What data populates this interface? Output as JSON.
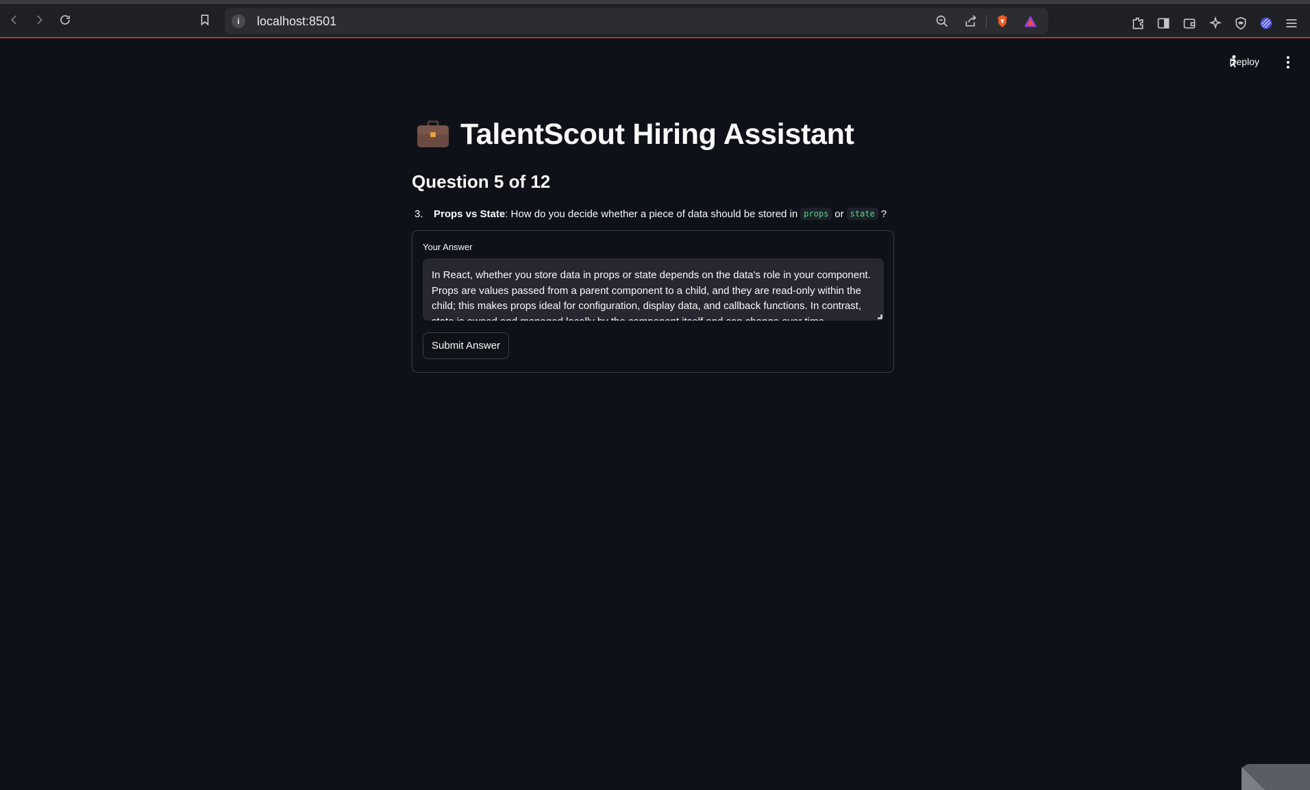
{
  "browser": {
    "url": "localhost:8501",
    "info_icon": "info-icon"
  },
  "header": {
    "deploy_label": "Deploy"
  },
  "main": {
    "title": "TalentScout Hiring Assistant",
    "title_icon": "briefcase-icon",
    "progress": "Question 5 of 12",
    "question": {
      "number": "3.",
      "topic": "Props vs State",
      "text_before": ": How do you decide whether a piece of data should be stored in",
      "code1": "props",
      "middle": "or",
      "code2": "state",
      "end": "?"
    },
    "form": {
      "label": "Your Answer",
      "answer": "In React, whether you store data in props or state depends on the data's role in your component. Props are values passed from a parent component to a child, and they are read-only within the child; this makes props ideal for configuration, display data, and callback functions. In contrast, state is owned and managed locally by the component itself and can change over time.",
      "submit_label": "Submit Answer"
    }
  }
}
